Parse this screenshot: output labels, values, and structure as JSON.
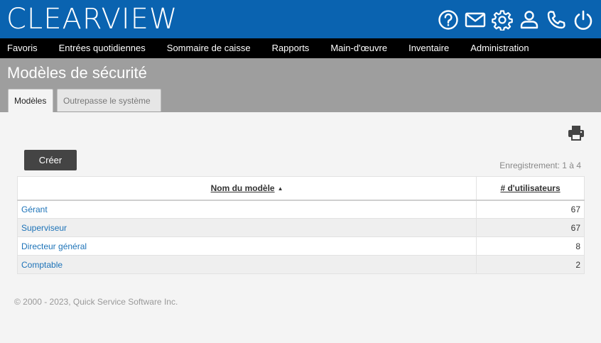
{
  "brand": {
    "logo_text": "CLEARVIEW",
    "color": "#0a63b0"
  },
  "top_icons": [
    "help-icon",
    "mail-icon",
    "gear-icon",
    "user-icon",
    "phone-icon",
    "power-icon"
  ],
  "nav": {
    "items": [
      "Favoris",
      "Entrées quotidiennes",
      "Sommaire de caisse",
      "Rapports",
      "Main-d'œuvre",
      "Inventaire",
      "Administration"
    ]
  },
  "page": {
    "title": "Modèles de sécurité",
    "tabs": [
      {
        "label": "Modèles",
        "active": true
      },
      {
        "label": "Outrepasse le système",
        "active": false
      }
    ]
  },
  "toolbar": {
    "create_label": "Créer",
    "record_count": "Enregistrement: 1 à 4"
  },
  "table": {
    "columns": {
      "name": "Nom du modèle",
      "sort_indicator": "▲",
      "users": "# d'utilisateurs"
    },
    "rows": [
      {
        "name": "Gérant",
        "users": "67"
      },
      {
        "name": "Superviseur",
        "users": "67"
      },
      {
        "name": "Directeur général",
        "users": "8"
      },
      {
        "name": "Comptable",
        "users": "2"
      }
    ]
  },
  "footer": {
    "copyright": "© 2000 - 2023, Quick Service Software Inc."
  }
}
